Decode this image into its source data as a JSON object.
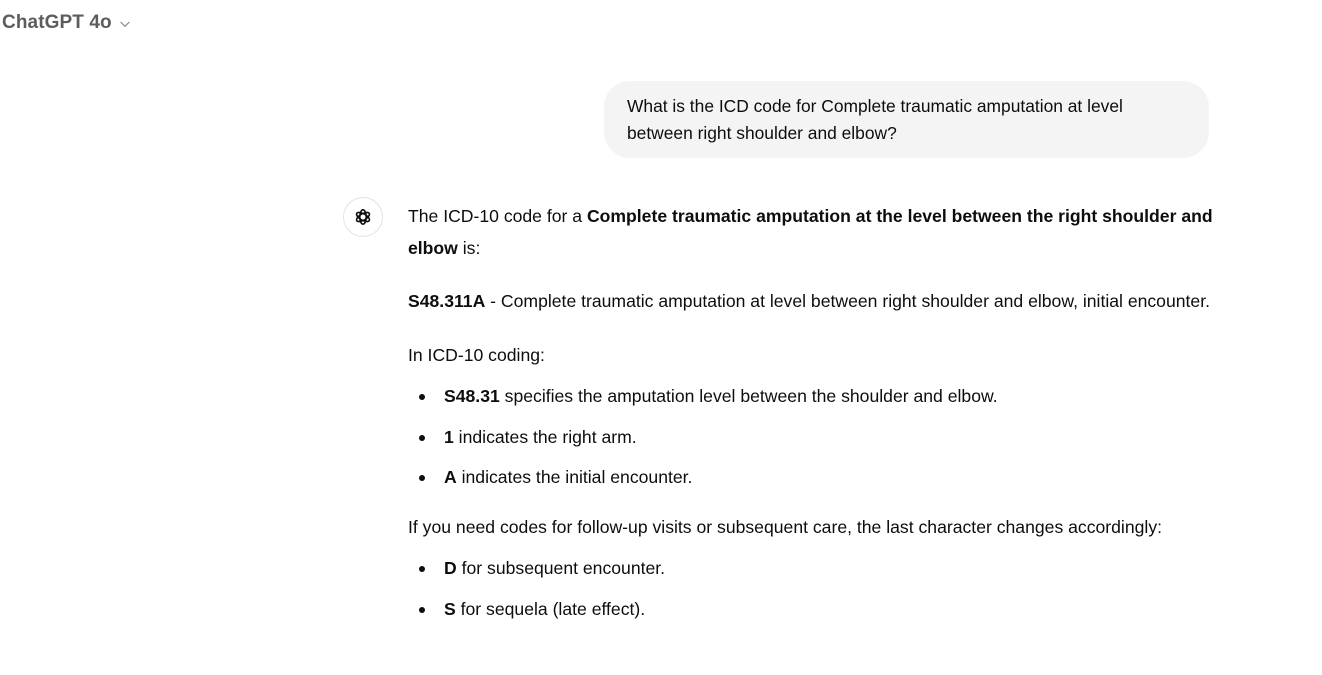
{
  "header": {
    "model_name": "ChatGPT 4o",
    "chevron_icon": "chevron-down-icon"
  },
  "conversation": {
    "user_message": {
      "line1": "What is the ICD code for Complete traumatic amputation at level",
      "line2": "between right shoulder and elbow?"
    },
    "assistant": {
      "avatar_icon": "openai-logo-icon",
      "intro": {
        "prefix": "The ICD-10 code for a ",
        "bold": "Complete traumatic amputation at the level between the right shoulder and elbow",
        "suffix": " is:"
      },
      "code_line": {
        "code": "S48.311A",
        "description": " - Complete traumatic amputation at level between right shoulder and elbow, initial encounter."
      },
      "coding_heading": "In ICD-10 coding:",
      "coding_items": [
        {
          "bold": "S48.31",
          "text": " specifies the amputation level between the shoulder and elbow."
        },
        {
          "bold": "1",
          "text": " indicates the right arm."
        },
        {
          "bold": "A",
          "text": " indicates the initial encounter."
        }
      ],
      "followup_text": "If you need codes for follow-up visits or subsequent care, the last character changes accordingly:",
      "followup_items": [
        {
          "bold": "D",
          "text": " for subsequent encounter."
        },
        {
          "bold": "S",
          "text": " for sequela (late effect)."
        }
      ]
    }
  },
  "colors": {
    "bubble_bg": "#f4f4f4",
    "text": "#0d0d0d",
    "muted": "#5d5d5d"
  }
}
